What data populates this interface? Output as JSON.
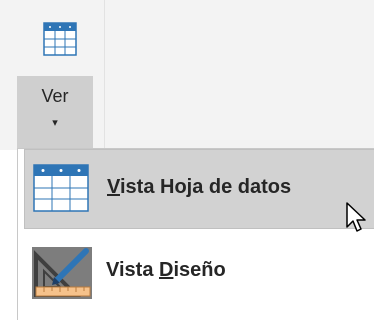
{
  "ribbon": {
    "view_button": {
      "label": "Ver",
      "dropdown_glyph": "▾",
      "icon": "datasheet-view-icon"
    }
  },
  "menu": {
    "items": [
      {
        "label_accesskey": "V",
        "label_rest": "ista Hoja de datos",
        "icon": "datasheet-view-icon",
        "highlighted": true
      },
      {
        "label_prefix": "Vista ",
        "label_accesskey": "D",
        "label_rest": "iseño",
        "icon": "design-view-icon",
        "highlighted": false
      }
    ]
  },
  "colors": {
    "ribbon_bg": "#f3f3f3",
    "highlight_bg": "#d2d2d2",
    "icon_blue": "#2e75b6",
    "text": "#262626"
  }
}
